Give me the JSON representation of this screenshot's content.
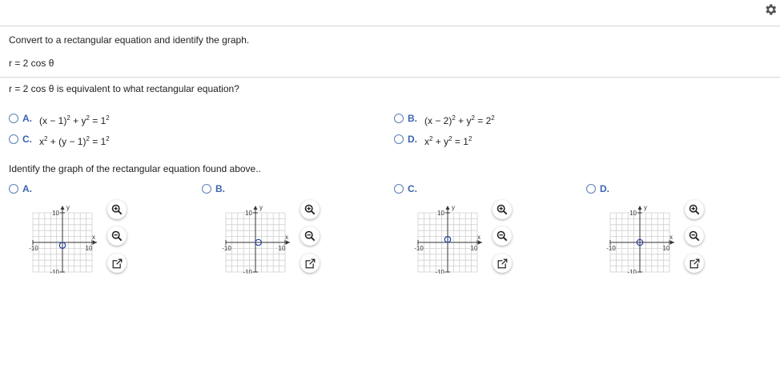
{
  "header": {
    "instruction": "Convert to a rectangular equation and identify the graph.",
    "given_equation": "r = 2 cos θ",
    "settings_icon": "gear-icon"
  },
  "part1": {
    "question": "r = 2 cos θ is equivalent to what rectangular equation?",
    "options": [
      {
        "letter": "A.",
        "eq": [
          "(x − 1)",
          "2",
          " + y",
          "2",
          " = 1",
          "2"
        ]
      },
      {
        "letter": "B.",
        "eq": [
          "(x − 2)",
          "2",
          " + y",
          "2",
          " = 2",
          "2"
        ]
      },
      {
        "letter": "C.",
        "eq": [
          "x",
          "2",
          " + (y − 1)",
          "2",
          " = 1",
          "2"
        ]
      },
      {
        "letter": "D.",
        "eq": [
          "x",
          "2",
          " + y",
          "2",
          " = 1",
          "2"
        ]
      }
    ]
  },
  "part2": {
    "question": "Identify the graph of the rectangular equation found above..",
    "options": [
      {
        "letter": "A.",
        "circle": {
          "cx": 0,
          "cy": -1,
          "r": 1
        }
      },
      {
        "letter": "B.",
        "circle": {
          "cx": 1,
          "cy": 0,
          "r": 1
        }
      },
      {
        "letter": "C.",
        "circle": {
          "cx": 0,
          "cy": 1,
          "r": 1
        }
      },
      {
        "letter": "D.",
        "circle": {
          "cx": 0,
          "cy": 0,
          "r": 1
        }
      }
    ],
    "graph_labels": {
      "y_axis": "y",
      "x_axis": "x",
      "y_max": "10",
      "y_min": "-10",
      "x_min": "-10",
      "x_max": "10"
    },
    "graph_range": {
      "xmin": -10,
      "xmax": 10,
      "ymin": -10,
      "ymax": 10
    },
    "tool_icons": [
      "zoom-in-icon",
      "zoom-out-icon",
      "expand-icon"
    ]
  },
  "colors": {
    "accent": "#3a64b0",
    "circle": "#1f3fa8",
    "grid": "#cfcfcf"
  }
}
